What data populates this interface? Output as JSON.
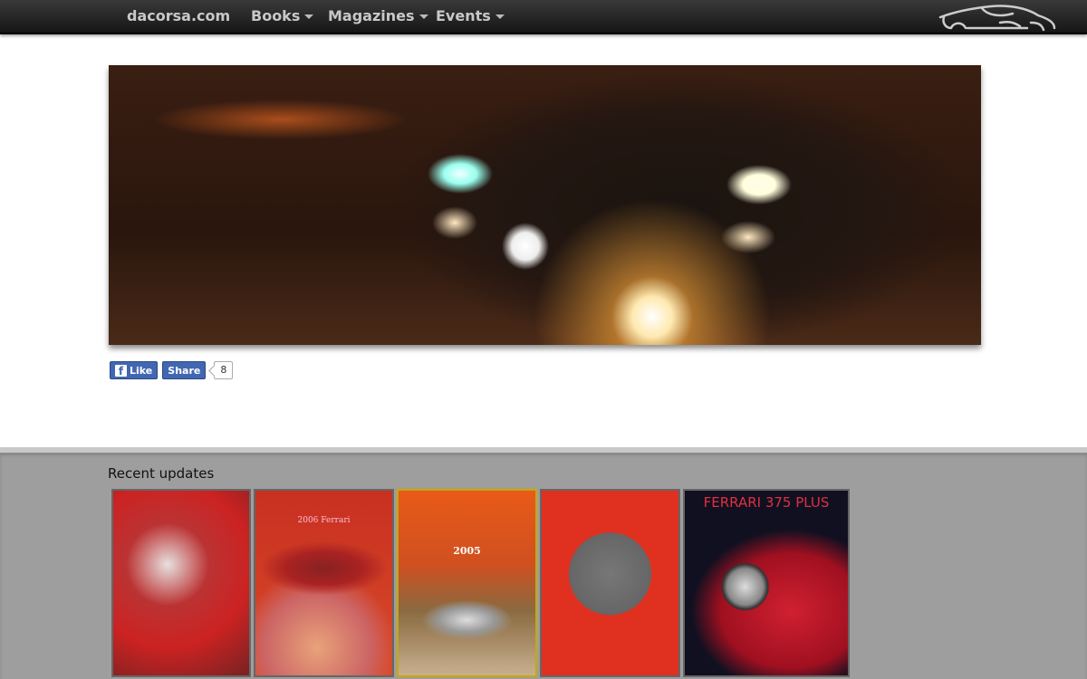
{
  "nav": {
    "brand": "dacorsa.com",
    "items": [
      {
        "label": "Books"
      },
      {
        "label": "Magazines"
      },
      {
        "label": "Events"
      }
    ]
  },
  "social": {
    "like_label": "Like",
    "share_label": "Share",
    "count": "8"
  },
  "recent": {
    "heading": "Recent updates",
    "covers": [
      {
        "lettering": ""
      },
      {
        "lettering": "2006 Ferrari"
      },
      {
        "lettering": "2005"
      },
      {
        "lettering": ""
      },
      {
        "lettering": "FERRARI 375 PLUS"
      }
    ]
  },
  "colors": {
    "nav": "#1f1f1f",
    "facebook": "#4267b2",
    "band": "#9e9e9e"
  }
}
